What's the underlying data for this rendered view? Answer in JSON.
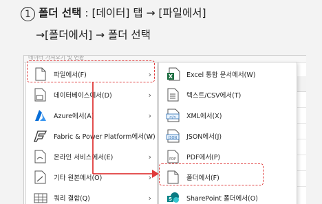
{
  "instruction": {
    "step_number": "1",
    "title": "폴더 선택",
    "line1_rest": " : [데이터] 탭 → [파일에서]",
    "line2": "→[폴더에서] → 폴더 선택"
  },
  "ribbon": {
    "text": "데이터 가져오기 및 변환"
  },
  "sheet": {
    "column_label": "G"
  },
  "menu_primary": {
    "items": [
      {
        "label": "파일에서(F)",
        "icon": "file-icon",
        "has_submenu": true
      },
      {
        "label": "데이터베이스에서(D)",
        "icon": "database-icon",
        "has_submenu": true
      },
      {
        "label": "Azure에서(A)",
        "icon": "azure-icon",
        "has_submenu": true
      },
      {
        "label": "Fabric & Power Platform에서(W)",
        "icon": "fabric-icon",
        "has_submenu": true
      },
      {
        "label": "온라인 서비스에서(E)",
        "icon": "online-service-icon",
        "has_submenu": true
      },
      {
        "label": "기타 원본에서(O)",
        "icon": "other-sources-icon",
        "has_submenu": true
      },
      {
        "label": "쿼리 결합(Q)",
        "icon": "combine-queries-icon",
        "has_submenu": true
      }
    ]
  },
  "menu_secondary": {
    "items": [
      {
        "label": "Excel 통합 문서에서(W)",
        "icon": "excel-icon"
      },
      {
        "label": "텍스트/CSV에서(T)",
        "icon": "text-csv-icon"
      },
      {
        "label": "XML에서(X)",
        "icon": "xml-icon"
      },
      {
        "label": "JSON에서(J)",
        "icon": "json-icon"
      },
      {
        "label": "PDF에서(P)",
        "icon": "pdf-icon"
      },
      {
        "label": "폴더에서(F)",
        "icon": "folder-icon"
      },
      {
        "label": "SharePoint 폴더에서(O)",
        "icon": "sharepoint-icon"
      }
    ]
  },
  "colors": {
    "highlight": "#e03b3b",
    "excel_green": "#1d6f42",
    "azure_blue": "#0a6fd8",
    "sharepoint_teal": "#038387"
  }
}
